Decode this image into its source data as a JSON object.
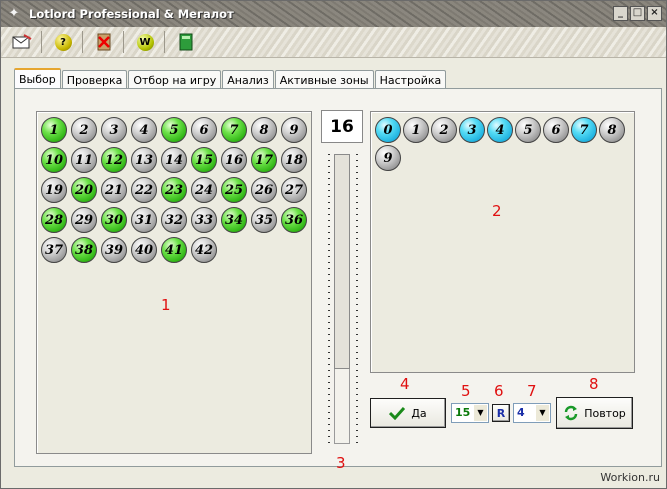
{
  "window": {
    "title": "Lotlord Professional & Мегалот"
  },
  "titlebar_buttons": [
    "minimize",
    "maximize",
    "close"
  ],
  "toolbar": {
    "icons": [
      "envelope-icon",
      "help-icon",
      "exit-icon",
      "web-icon",
      "book-icon"
    ],
    "help_glyph": "?",
    "web_glyph": "W"
  },
  "tabs": [
    "Выбор",
    "Проверка",
    "Отбор на игру",
    "Анализ",
    "Активные зоны",
    "Настройка"
  ],
  "active_tab": "Выбор",
  "left_panel": {
    "balls": [
      {
        "n": "1",
        "c": "green"
      },
      {
        "n": "2",
        "c": "gray"
      },
      {
        "n": "3",
        "c": "gray"
      },
      {
        "n": "4",
        "c": "gray"
      },
      {
        "n": "5",
        "c": "green"
      },
      {
        "n": "6",
        "c": "gray"
      },
      {
        "n": "7",
        "c": "green"
      },
      {
        "n": "8",
        "c": "gray"
      },
      {
        "n": "9",
        "c": "gray"
      },
      {
        "n": "10",
        "c": "green"
      },
      {
        "n": "11",
        "c": "gray"
      },
      {
        "n": "12",
        "c": "green"
      },
      {
        "n": "13",
        "c": "gray"
      },
      {
        "n": "14",
        "c": "gray"
      },
      {
        "n": "15",
        "c": "green"
      },
      {
        "n": "16",
        "c": "gray"
      },
      {
        "n": "17",
        "c": "green"
      },
      {
        "n": "18",
        "c": "gray"
      },
      {
        "n": "19",
        "c": "gray"
      },
      {
        "n": "20",
        "c": "green"
      },
      {
        "n": "21",
        "c": "gray"
      },
      {
        "n": "22",
        "c": "gray"
      },
      {
        "n": "23",
        "c": "green"
      },
      {
        "n": "24",
        "c": "gray"
      },
      {
        "n": "25",
        "c": "green"
      },
      {
        "n": "26",
        "c": "gray"
      },
      {
        "n": "27",
        "c": "gray"
      },
      {
        "n": "28",
        "c": "green"
      },
      {
        "n": "29",
        "c": "gray"
      },
      {
        "n": "30",
        "c": "green"
      },
      {
        "n": "31",
        "c": "gray"
      },
      {
        "n": "32",
        "c": "gray"
      },
      {
        "n": "33",
        "c": "gray"
      },
      {
        "n": "34",
        "c": "green"
      },
      {
        "n": "35",
        "c": "gray"
      },
      {
        "n": "36",
        "c": "green"
      },
      {
        "n": "37",
        "c": "gray"
      },
      {
        "n": "38",
        "c": "green"
      },
      {
        "n": "39",
        "c": "gray"
      },
      {
        "n": "40",
        "c": "gray"
      },
      {
        "n": "41",
        "c": "green"
      },
      {
        "n": "42",
        "c": "gray"
      }
    ]
  },
  "counter": "16",
  "slider": {
    "level_fraction": 0.26
  },
  "right_panel": {
    "balls": [
      {
        "n": "0",
        "c": "cyan"
      },
      {
        "n": "1",
        "c": "gray"
      },
      {
        "n": "2",
        "c": "gray"
      },
      {
        "n": "3",
        "c": "cyan"
      },
      {
        "n": "4",
        "c": "cyan"
      },
      {
        "n": "5",
        "c": "gray"
      },
      {
        "n": "6",
        "c": "gray"
      },
      {
        "n": "7",
        "c": "cyan"
      },
      {
        "n": "8",
        "c": "gray"
      },
      {
        "n": "9",
        "c": "gray"
      }
    ]
  },
  "controls": {
    "yes_label": "Да",
    "combo1_value": "15",
    "r_label": "R",
    "combo2_value": "4",
    "repeat_label": "Повтор"
  },
  "annotations": [
    "1",
    "2",
    "3",
    "4",
    "5",
    "6",
    "7",
    "8"
  ],
  "watermark": "Workion.ru",
  "colors": {
    "green_ball": "#2fb514",
    "cyan_ball": "#1fb2e0",
    "gray_ball": "#9a9a9a",
    "annotation": "#e01010",
    "tab_highlight": "#e6a62f"
  }
}
